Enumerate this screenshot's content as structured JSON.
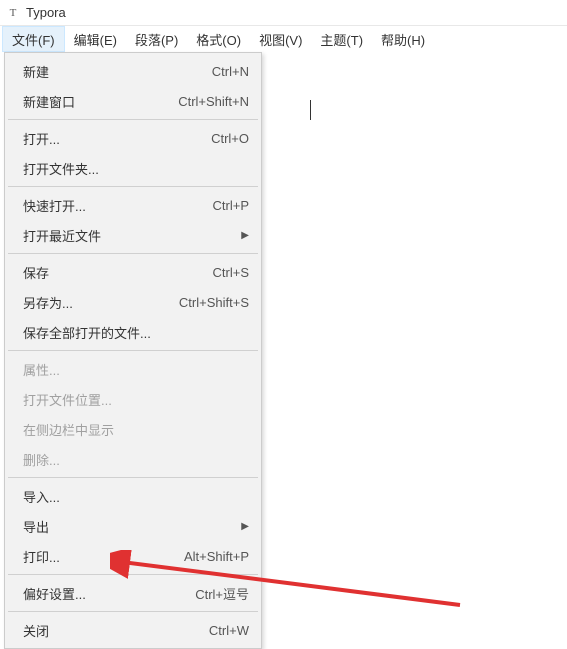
{
  "titlebar": {
    "icon_glyph": "T",
    "title": "Typora"
  },
  "menubar": {
    "items": [
      {
        "label": "文件(F)",
        "active": true
      },
      {
        "label": "编辑(E)",
        "active": false
      },
      {
        "label": "段落(P)",
        "active": false
      },
      {
        "label": "格式(O)",
        "active": false
      },
      {
        "label": "视图(V)",
        "active": false
      },
      {
        "label": "主题(T)",
        "active": false
      },
      {
        "label": "帮助(H)",
        "active": false
      }
    ]
  },
  "dropdown": {
    "groups": [
      [
        {
          "label": "新建",
          "shortcut": "Ctrl+N",
          "submenu": false,
          "disabled": false
        },
        {
          "label": "新建窗口",
          "shortcut": "Ctrl+Shift+N",
          "submenu": false,
          "disabled": false
        }
      ],
      [
        {
          "label": "打开...",
          "shortcut": "Ctrl+O",
          "submenu": false,
          "disabled": false
        },
        {
          "label": "打开文件夹...",
          "shortcut": "",
          "submenu": false,
          "disabled": false
        }
      ],
      [
        {
          "label": "快速打开...",
          "shortcut": "Ctrl+P",
          "submenu": false,
          "disabled": false
        },
        {
          "label": "打开最近文件",
          "shortcut": "",
          "submenu": true,
          "disabled": false
        }
      ],
      [
        {
          "label": "保存",
          "shortcut": "Ctrl+S",
          "submenu": false,
          "disabled": false
        },
        {
          "label": "另存为...",
          "shortcut": "Ctrl+Shift+S",
          "submenu": false,
          "disabled": false
        },
        {
          "label": "保存全部打开的文件...",
          "shortcut": "",
          "submenu": false,
          "disabled": false
        }
      ],
      [
        {
          "label": "属性...",
          "shortcut": "",
          "submenu": false,
          "disabled": true
        },
        {
          "label": "打开文件位置...",
          "shortcut": "",
          "submenu": false,
          "disabled": true
        },
        {
          "label": "在侧边栏中显示",
          "shortcut": "",
          "submenu": false,
          "disabled": true
        },
        {
          "label": "删除...",
          "shortcut": "",
          "submenu": false,
          "disabled": true
        }
      ],
      [
        {
          "label": "导入...",
          "shortcut": "",
          "submenu": false,
          "disabled": false
        },
        {
          "label": "导出",
          "shortcut": "",
          "submenu": true,
          "disabled": false
        },
        {
          "label": "打印...",
          "shortcut": "Alt+Shift+P",
          "submenu": false,
          "disabled": false
        }
      ],
      [
        {
          "label": "偏好设置...",
          "shortcut": "Ctrl+逗号",
          "submenu": false,
          "disabled": false
        }
      ],
      [
        {
          "label": "关闭",
          "shortcut": "Ctrl+W",
          "submenu": false,
          "disabled": false
        }
      ]
    ]
  },
  "annotation": {
    "color": "#e03131"
  }
}
